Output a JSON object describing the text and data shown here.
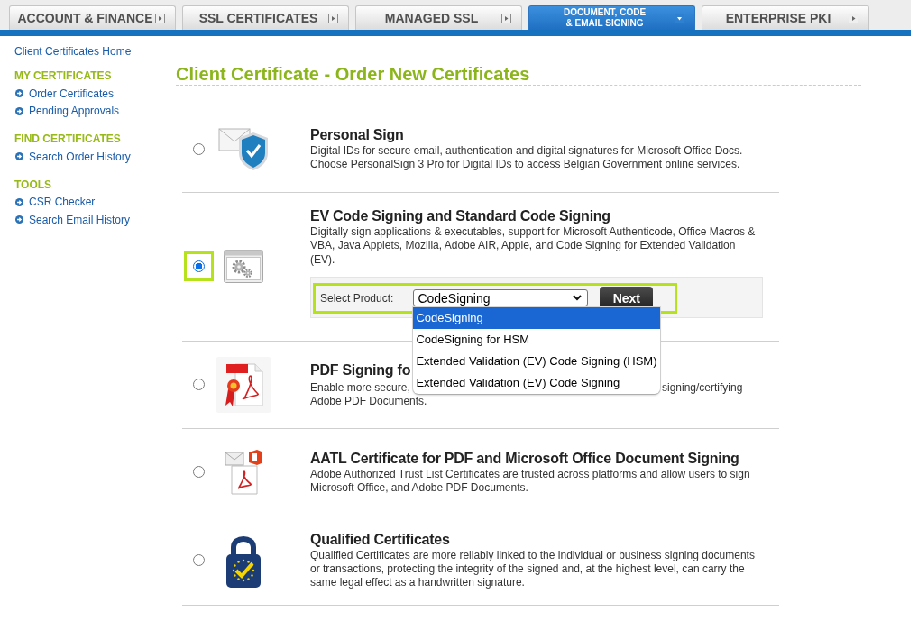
{
  "nav_tabs": [
    {
      "label": "ACCOUNT & FINANCE",
      "selected": false
    },
    {
      "label": "SSL CERTIFICATES",
      "selected": false
    },
    {
      "label": "MANAGED SSL",
      "selected": false
    },
    {
      "label": "DOCUMENT, CODE\n& EMAIL SIGNING",
      "selected": true
    },
    {
      "label": "ENTERPRISE PKI",
      "selected": false
    }
  ],
  "sidebar": {
    "home_link": "Client Certificates Home",
    "sections": [
      {
        "heading": "MY CERTIFICATES",
        "links": [
          "Order Certificates",
          "Pending Approvals"
        ]
      },
      {
        "heading": "FIND CERTIFICATES",
        "links": [
          "Search Order History"
        ]
      },
      {
        "heading": "TOOLS",
        "links": [
          "CSR Checker",
          "Search Email History"
        ]
      }
    ]
  },
  "page_title": "Client Certificate - Order New Certificates",
  "products": [
    {
      "kind": "personal-sign",
      "title": "Personal Sign",
      "description": "Digital IDs for secure email, authentication and digital signatures for Microsoft Office Docs. Choose PersonalSign 3 Pro for Digital IDs to access Belgian Government online services.",
      "selected": false,
      "highlighted": false
    },
    {
      "kind": "code-signing",
      "title": "EV Code Signing and Standard Code Signing",
      "description": "Digitally sign applications & executables, support for Microsoft Authenticode, Office Macros & VBA, Java Applets, Mozilla, Adobe AIR, Apple, and Code Signing for Extended Validation (EV).",
      "selected": true,
      "highlighted": true,
      "product_select": {
        "label": "Select Product:",
        "value": "CodeSigning",
        "button": "Next",
        "highlighted": true,
        "expanded": true,
        "options": [
          {
            "label": "CodeSigning",
            "selected": true
          },
          {
            "label": "CodeSigning for HSM",
            "selected": false
          },
          {
            "label": "Extended Validation (EV) Code Signing (HSM)",
            "selected": false
          },
          {
            "label": "Extended Validation (EV) Code Signing",
            "selected": false
          }
        ]
      }
    },
    {
      "kind": "pdf-signing",
      "title": "PDF Signing fo",
      "description_lines": [
        [
          "Enable more secure,",
          "signing/certifying"
        ],
        [
          "Adobe PDF Documents."
        ]
      ],
      "selected": false,
      "highlighted": false
    },
    {
      "kind": "aatl",
      "title": "AATL Certificate for PDF and Microsoft Office Document Signing",
      "description": "Adobe Authorized Trust List Certificates are trusted across platforms and allow users to sign Microsoft Office, and Adobe PDF Documents.",
      "selected": false,
      "highlighted": false
    },
    {
      "kind": "qualified",
      "title": "Qualified Certificates",
      "description": "Qualified Certificates are more reliably linked to the individual or business signing documents or transactions, protecting the integrity of the signed and, at the highest level, can carry the same legal effect as a handwritten signature.",
      "selected": false,
      "highlighted": false
    }
  ]
}
